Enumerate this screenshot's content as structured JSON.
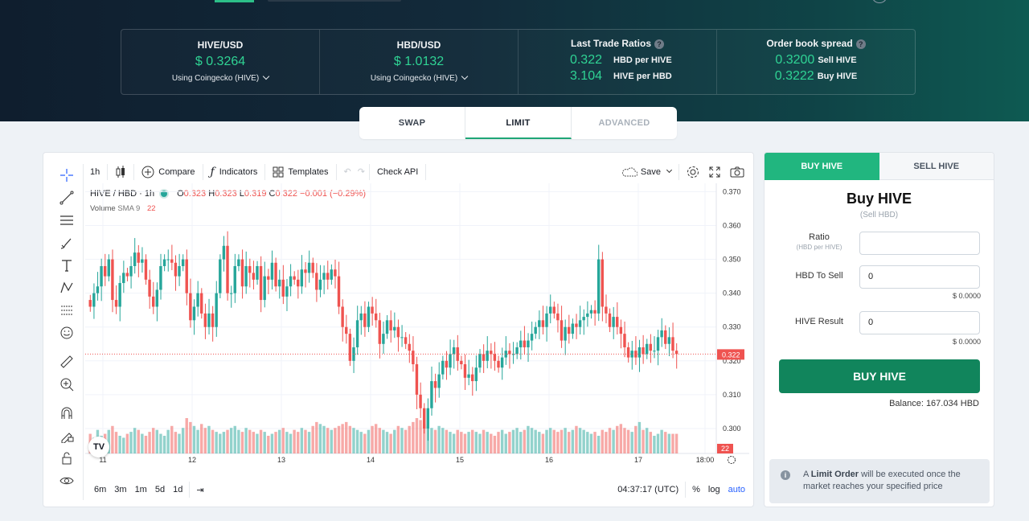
{
  "stats": {
    "hive_usd": {
      "title": "HIVE/USD",
      "price": "$ 0.3264",
      "source": "Using Coingecko (HIVE)"
    },
    "hbd_usd": {
      "title": "HBD/USD",
      "price": "$ 1.0132",
      "source": "Using Coingecko (HIVE)"
    },
    "last_trade": {
      "title": "Last Trade Ratios",
      "help": "?",
      "rows": [
        {
          "value": "0.322",
          "label": "HBD per HIVE"
        },
        {
          "value": "3.104",
          "label": "HIVE per HBD"
        }
      ]
    },
    "spread": {
      "title": "Order book spread",
      "help": "?",
      "rows": [
        {
          "value": "0.3200",
          "label": "Sell HIVE"
        },
        {
          "value": "0.3222",
          "label": "Buy HIVE"
        }
      ]
    }
  },
  "mode_tabs": [
    "SWAP",
    "LIMIT",
    "ADVANCED"
  ],
  "toolbar": {
    "interval": "1h",
    "compare": "Compare",
    "indicators": "Indicators",
    "templates": "Templates",
    "check_api": "Check API",
    "save": "Save"
  },
  "legend": {
    "symbol": "HIVE / HBD · 1h",
    "o_label": "O",
    "o": "0.323",
    "h_label": "H",
    "h": "0.323",
    "l_label": "L",
    "l": "0.319",
    "c_label": "C",
    "c": "0.322",
    "change": "−0.001 (−0.29%)",
    "volume_label": "Volume",
    "sma_label": "SMA 9",
    "sma_value": "22"
  },
  "bottombar": {
    "ranges": [
      "6m",
      "3m",
      "1m",
      "5d",
      "1d"
    ],
    "time": "04:37:17 (UTC)",
    "percent": "%",
    "log": "log",
    "auto": "auto"
  },
  "chart_data": {
    "type": "candlestick",
    "y_ticks": [
      "0.370",
      "0.360",
      "0.350",
      "0.340",
      "0.330",
      "0.320",
      "0.310",
      "0.300"
    ],
    "x_ticks": [
      "11",
      "12",
      "13",
      "14",
      "15",
      "16",
      "17",
      "18:00"
    ],
    "last_price_label": "0.322",
    "volume_sma_label": "22",
    "ylim": [
      0.295,
      0.372
    ],
    "last_price": 0.322,
    "closes": [
      0.336,
      0.34,
      0.342,
      0.348,
      0.345,
      0.35,
      0.338,
      0.336,
      0.343,
      0.346,
      0.345,
      0.348,
      0.352,
      0.349,
      0.35,
      0.344,
      0.339,
      0.336,
      0.341,
      0.348,
      0.35,
      0.35,
      0.349,
      0.345,
      0.348,
      0.35,
      0.34,
      0.332,
      0.336,
      0.34,
      0.334,
      0.33,
      0.334,
      0.33,
      0.34,
      0.35,
      0.354,
      0.34,
      0.34,
      0.348,
      0.35,
      0.342,
      0.348,
      0.346,
      0.344,
      0.348,
      0.338,
      0.345,
      0.344,
      0.349,
      0.342,
      0.344,
      0.339,
      0.342,
      0.345,
      0.344,
      0.342,
      0.347,
      0.346,
      0.349,
      0.346,
      0.341,
      0.344,
      0.346,
      0.344,
      0.347,
      0.345,
      0.336,
      0.33,
      0.328,
      0.32,
      0.324,
      0.332,
      0.334,
      0.33,
      0.336,
      0.334,
      0.332,
      0.325,
      0.328,
      0.332,
      0.329,
      0.33,
      0.327,
      0.327,
      0.325,
      0.323,
      0.319,
      0.31,
      0.306,
      0.3,
      0.306,
      0.314,
      0.312,
      0.316,
      0.32,
      0.318,
      0.322,
      0.324,
      0.32,
      0.319,
      0.315,
      0.316,
      0.314,
      0.318,
      0.322,
      0.32,
      0.323,
      0.322,
      0.32,
      0.318,
      0.321,
      0.323,
      0.322,
      0.322,
      0.324,
      0.326,
      0.324,
      0.326,
      0.328,
      0.33,
      0.332,
      0.33,
      0.334,
      0.336,
      0.334,
      0.332,
      0.326,
      0.33,
      0.328,
      0.331,
      0.33,
      0.332,
      0.333,
      0.334,
      0.335,
      0.334,
      0.35,
      0.336,
      0.334,
      0.33,
      0.333,
      0.33,
      0.328,
      0.324,
      0.321,
      0.323,
      0.321,
      0.324,
      0.322,
      0.325,
      0.323,
      0.323,
      0.327,
      0.329,
      0.325,
      0.327,
      0.323,
      0.322
    ],
    "volumes": [
      10,
      8,
      12,
      9,
      10,
      12,
      14,
      11,
      9,
      8,
      10,
      11,
      13,
      12,
      10,
      9,
      11,
      13,
      12,
      10,
      9,
      12,
      14,
      11,
      10,
      13,
      18,
      16,
      14,
      12,
      15,
      13,
      14,
      12,
      11,
      10,
      11,
      12,
      13,
      14,
      12,
      11,
      13,
      12,
      11,
      10,
      12,
      11,
      9,
      10,
      11,
      12,
      13,
      11,
      10,
      12,
      11,
      13,
      12,
      11,
      14,
      16,
      15,
      14,
      13,
      12,
      13,
      14,
      15,
      16,
      14,
      13,
      12,
      11,
      10,
      12,
      14,
      15,
      13,
      12,
      11,
      10,
      12,
      14,
      13,
      12,
      14,
      16,
      18,
      17,
      15,
      14,
      13,
      12,
      14,
      13,
      12,
      11,
      10,
      12,
      11,
      10,
      11,
      12,
      11,
      10,
      12,
      11,
      10,
      9,
      11,
      12,
      10,
      11,
      12,
      13,
      11,
      12,
      14,
      13,
      12,
      11,
      10,
      12,
      13,
      12,
      11,
      12,
      13,
      11,
      12,
      14,
      13,
      12,
      11,
      10,
      11,
      9,
      12,
      11,
      13,
      12,
      14,
      15,
      13,
      12,
      11,
      14,
      16,
      12,
      13,
      11,
      9,
      10,
      12,
      11,
      10
    ]
  },
  "order": {
    "tabs": {
      "buy": "BUY HIVE",
      "sell": "SELL HIVE"
    },
    "title": "Buy HIVE",
    "subtitle": "(Sell HBD)",
    "ratio_label": "Ratio",
    "ratio_sub": "(HBD per HIVE)",
    "ratio_value": "",
    "sell_label": "HBD To Sell",
    "sell_value": "0",
    "sell_usd": "$ 0.0000",
    "result_label": "HIVE Result",
    "result_value": "0",
    "result_usd": "$ 0.0000",
    "button": "BUY HIVE",
    "balance": "Balance: 167.034 HBD",
    "note_pre": "A",
    "note_bold": "Limit Order",
    "note_post": "will be executed once the market reaches your specified price"
  },
  "colors": {
    "up": "#26a69a",
    "down": "#ef5350",
    "accent": "#21b67f",
    "button": "#11855c"
  }
}
